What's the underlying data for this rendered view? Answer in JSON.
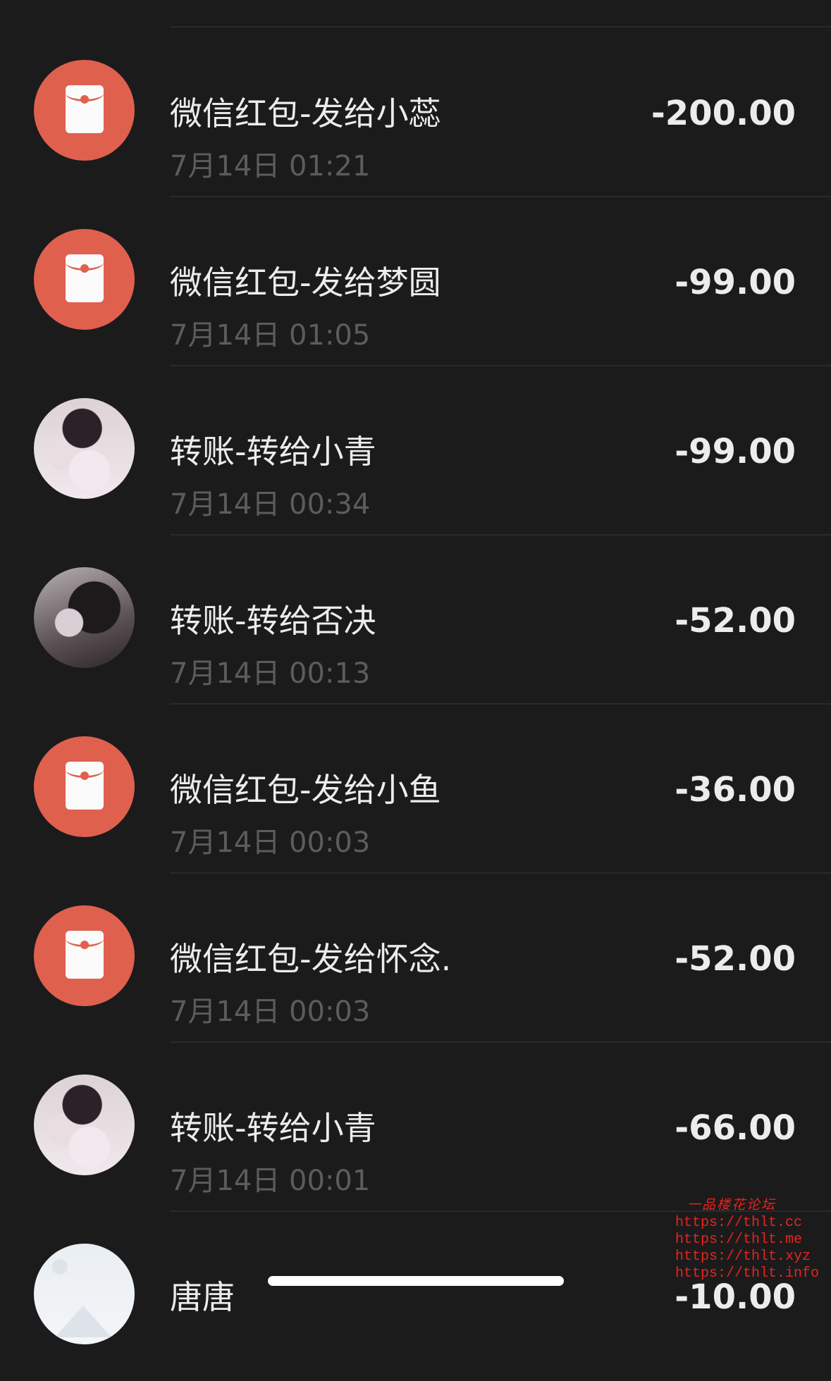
{
  "transactions": [
    {
      "avatar": "red-packet-icon",
      "title": "微信红包-发给小蕊",
      "time": "7月14日 01:21",
      "amount": "-200.00"
    },
    {
      "avatar": "red-packet-icon",
      "title": "微信红包-发给梦圆",
      "time": "7月14日 01:05",
      "amount": "-99.00"
    },
    {
      "avatar": "user-photo",
      "title": "转账-转给小青",
      "time": "7月14日 00:34",
      "amount": "-99.00"
    },
    {
      "avatar": "user-photo",
      "title": "转账-转给否决",
      "time": "7月14日 00:13",
      "amount": "-52.00"
    },
    {
      "avatar": "red-packet-icon",
      "title": "微信红包-发给小鱼",
      "time": "7月14日 00:03",
      "amount": "-36.00"
    },
    {
      "avatar": "red-packet-icon",
      "title": "微信红包-发给怀念.",
      "time": "7月14日 00:03",
      "amount": "-52.00"
    },
    {
      "avatar": "user-photo",
      "title": "转账-转给小青",
      "time": "7月14日 00:01",
      "amount": "-66.00"
    },
    {
      "avatar": "placeholder-image-icon",
      "title": "唐唐",
      "time": "",
      "amount": "-10.00"
    }
  ],
  "watermark": {
    "title": "一品楼花论坛",
    "lines": [
      "https://thlt.cc",
      "https://thlt.me",
      "https://thlt.xyz",
      "https://thlt.info"
    ]
  },
  "colors": {
    "background": "#1b1b1c",
    "red_packet": "#e0604e",
    "primary_text": "#ececec",
    "secondary_text": "#5c5c5e",
    "watermark": "#e8231e"
  }
}
